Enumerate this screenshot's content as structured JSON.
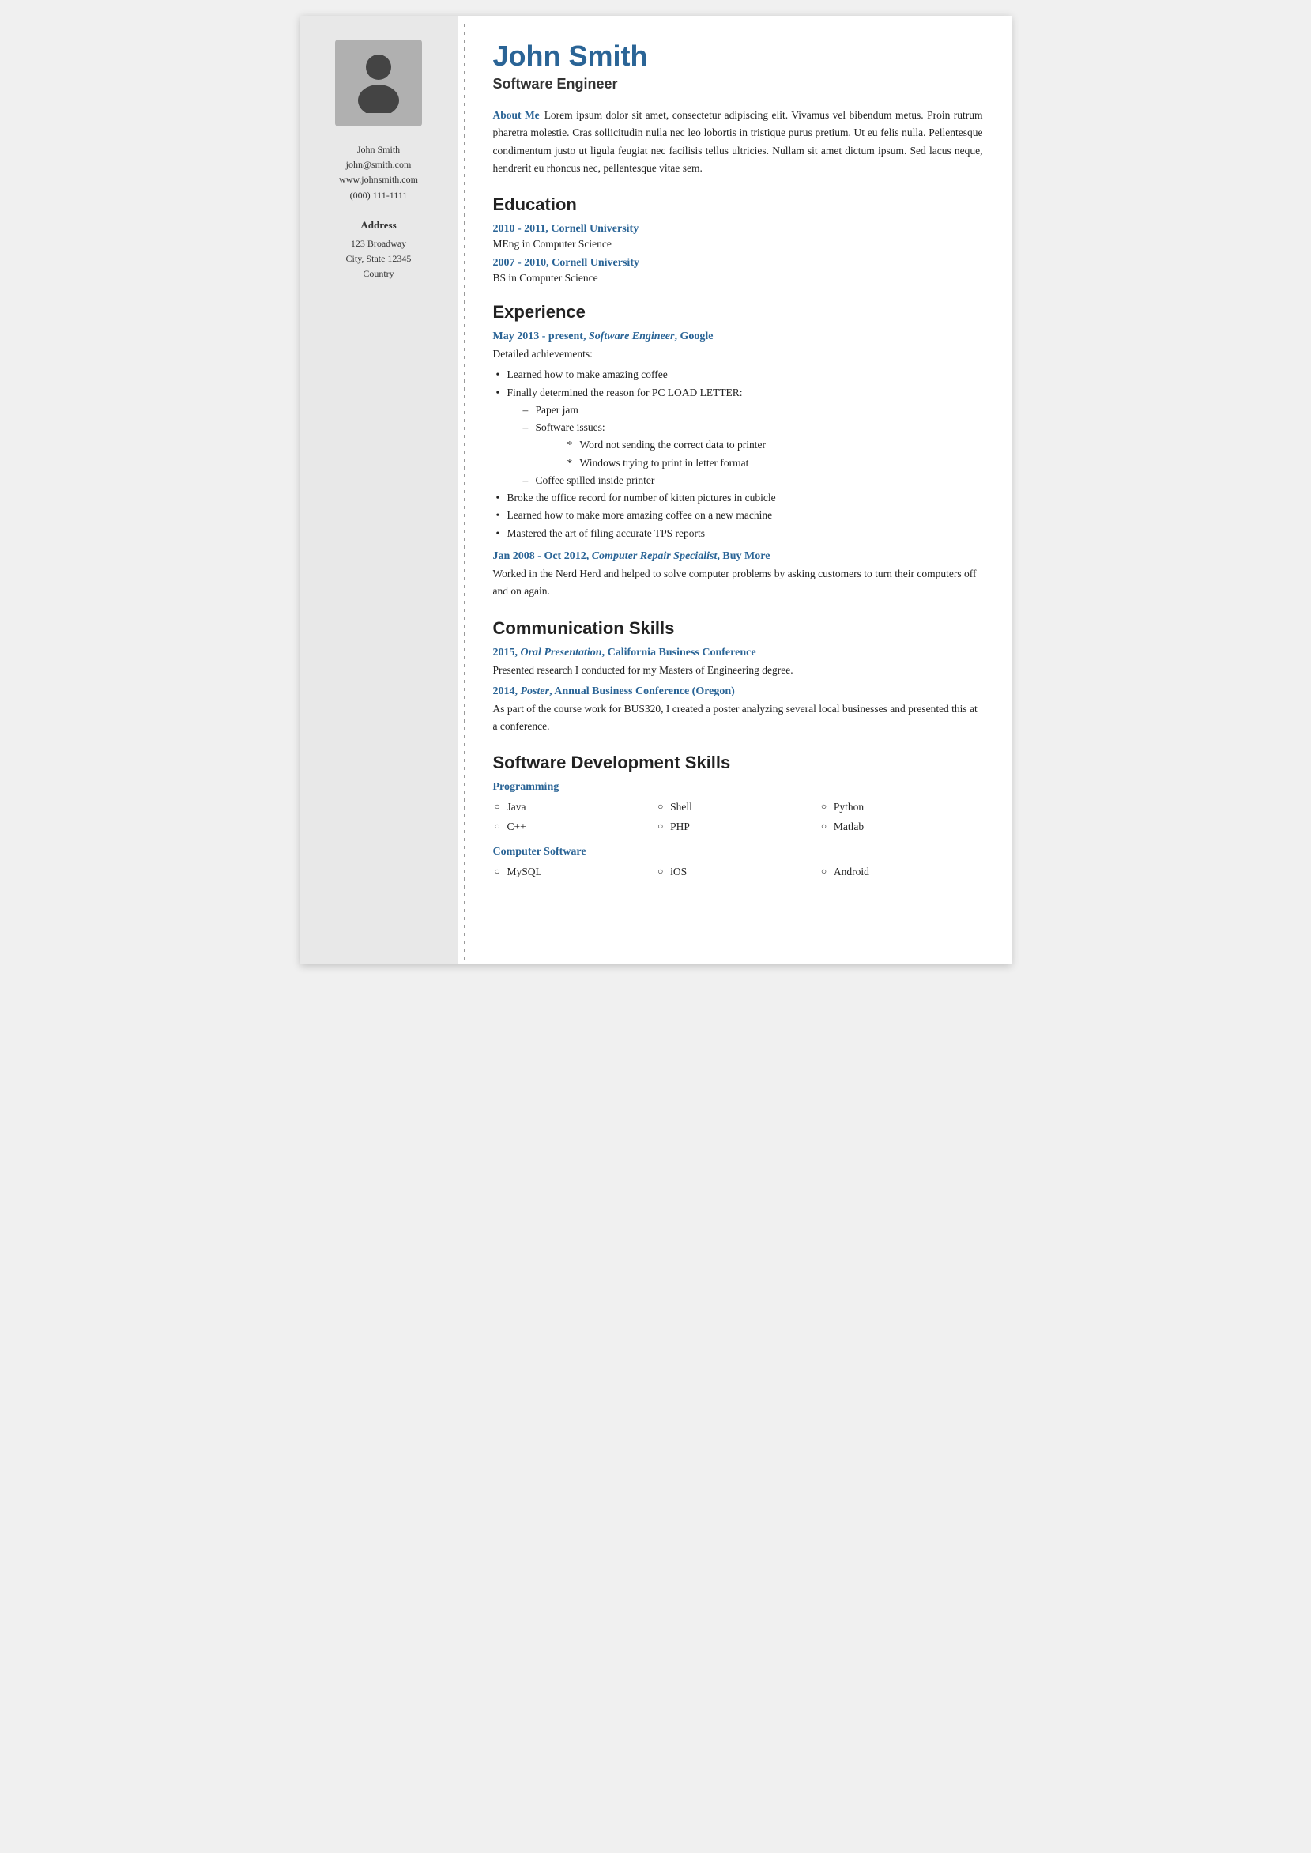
{
  "sidebar": {
    "name": "John Smith",
    "email": "john@smith.com",
    "website": "www.johnsmith.com",
    "phone": "(000) 111-1111",
    "address_label": "Address",
    "address_line1": "123 Broadway",
    "address_line2": "City, State 12345",
    "address_line3": "Country"
  },
  "main": {
    "name": "John Smith",
    "title": "Software Engineer",
    "about_me_label": "About Me",
    "about_me_text": "Lorem ipsum dolor sit amet, consectetur adipiscing elit. Vivamus vel bibendum metus. Proin rutrum pharetra molestie. Cras sollicitudin nulla nec leo lobortis in tristique purus pretium. Ut eu felis nulla. Pellentesque condimentum justo ut ligula feugiat nec facilisis tellus ultricies. Nullam sit amet dictum ipsum. Sed lacus neque, hendrerit eu rhoncus nec, pellentesque vitae sem.",
    "education_heading": "Education",
    "education": [
      {
        "title": "2010 - 2011, Cornell University",
        "degree": "MEng in Computer Science"
      },
      {
        "title": "2007 - 2010, Cornell University",
        "degree": "BS in Computer Science"
      }
    ],
    "experience_heading": "Experience",
    "experience": [
      {
        "title": "May 2013 - present, Software Engineer, Google",
        "body": "Detailed achievements:",
        "bullets": [
          "Learned how to make amazing coffee",
          "Finally determined the reason for PC LOAD LETTER:"
        ],
        "sub_bullets_index": 1,
        "sub_bullets": [
          "Paper jam",
          "Software issues:"
        ],
        "sub_sub_bullets_index": 1,
        "sub_sub_bullets": [
          "Word not sending the correct data to printer",
          "Windows trying to print in letter format"
        ],
        "sub_bullets_extra": [
          "Coffee spilled inside printer"
        ],
        "bullets_extra": [
          "Broke the office record for number of kitten pictures in cubicle",
          "Learned how to make more amazing coffee on a new machine",
          "Mastered the art of filing accurate TPS reports"
        ]
      },
      {
        "title": "Jan 2008 - Oct 2012, Computer Repair Specialist, Buy More",
        "body": "Worked in the Nerd Herd and helped to solve computer problems by asking customers to turn their computers off and on again."
      }
    ],
    "communication_heading": "Communication Skills",
    "communication": [
      {
        "title": "2015, Oral Presentation, California Business Conference",
        "body": "Presented research I conducted for my Masters of Engineering degree."
      },
      {
        "title": "2014, Poster, Annual Business Conference (Oregon)",
        "body": "As part of the course work for BUS320, I created a poster analyzing several local businesses and presented this at a conference."
      }
    ],
    "skills_heading": "Software Development Skills",
    "skills_subsections": [
      {
        "label": "Programming",
        "items": [
          "Java",
          "Shell",
          "Python",
          "C++",
          "PHP",
          "Matlab"
        ]
      },
      {
        "label": "Computer Software",
        "items": [
          "MySQL",
          "iOS",
          "Android"
        ]
      }
    ]
  }
}
